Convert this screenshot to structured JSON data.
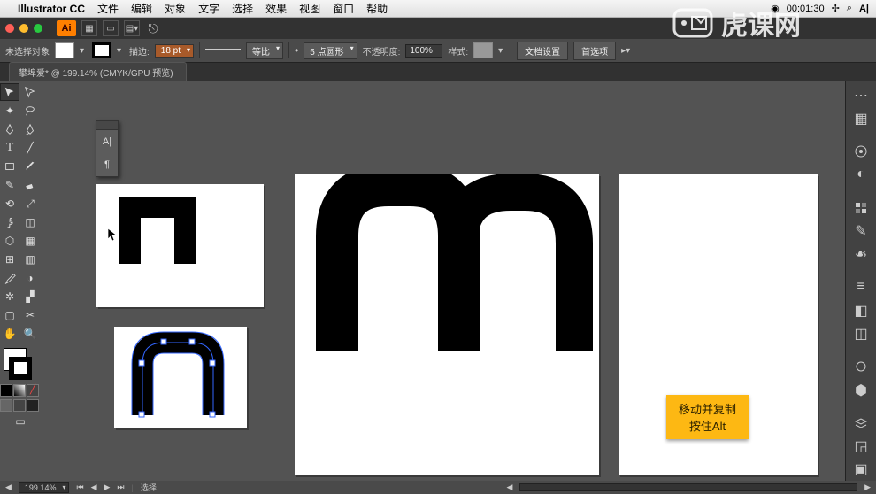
{
  "mac": {
    "app": "Illustrator CC",
    "menus": [
      "文件",
      "编辑",
      "对象",
      "文字",
      "选择",
      "效果",
      "视图",
      "窗口",
      "帮助"
    ],
    "clock": "00:01:30"
  },
  "topbar": {
    "ai": "Ai"
  },
  "control": {
    "no_selection": "未选择对象",
    "stroke_label": "描边:",
    "stroke_pt": "18 pt",
    "uniform": "等比",
    "brush": "5 点圆形",
    "opacity_label": "不透明度:",
    "opacity_val": "100%",
    "style_label": "样式:",
    "doc_setup": "文档设置",
    "prefs": "首选项"
  },
  "doc_tab": "攀埠爱* @ 199.14% (CMYK/GPU 预览)",
  "float_label": "A|",
  "status": {
    "zoom": "199.14%",
    "tool": "选择"
  },
  "tooltip": {
    "l1": "移动并复制",
    "l2": "按住Alt"
  },
  "watermark": "虎课网"
}
